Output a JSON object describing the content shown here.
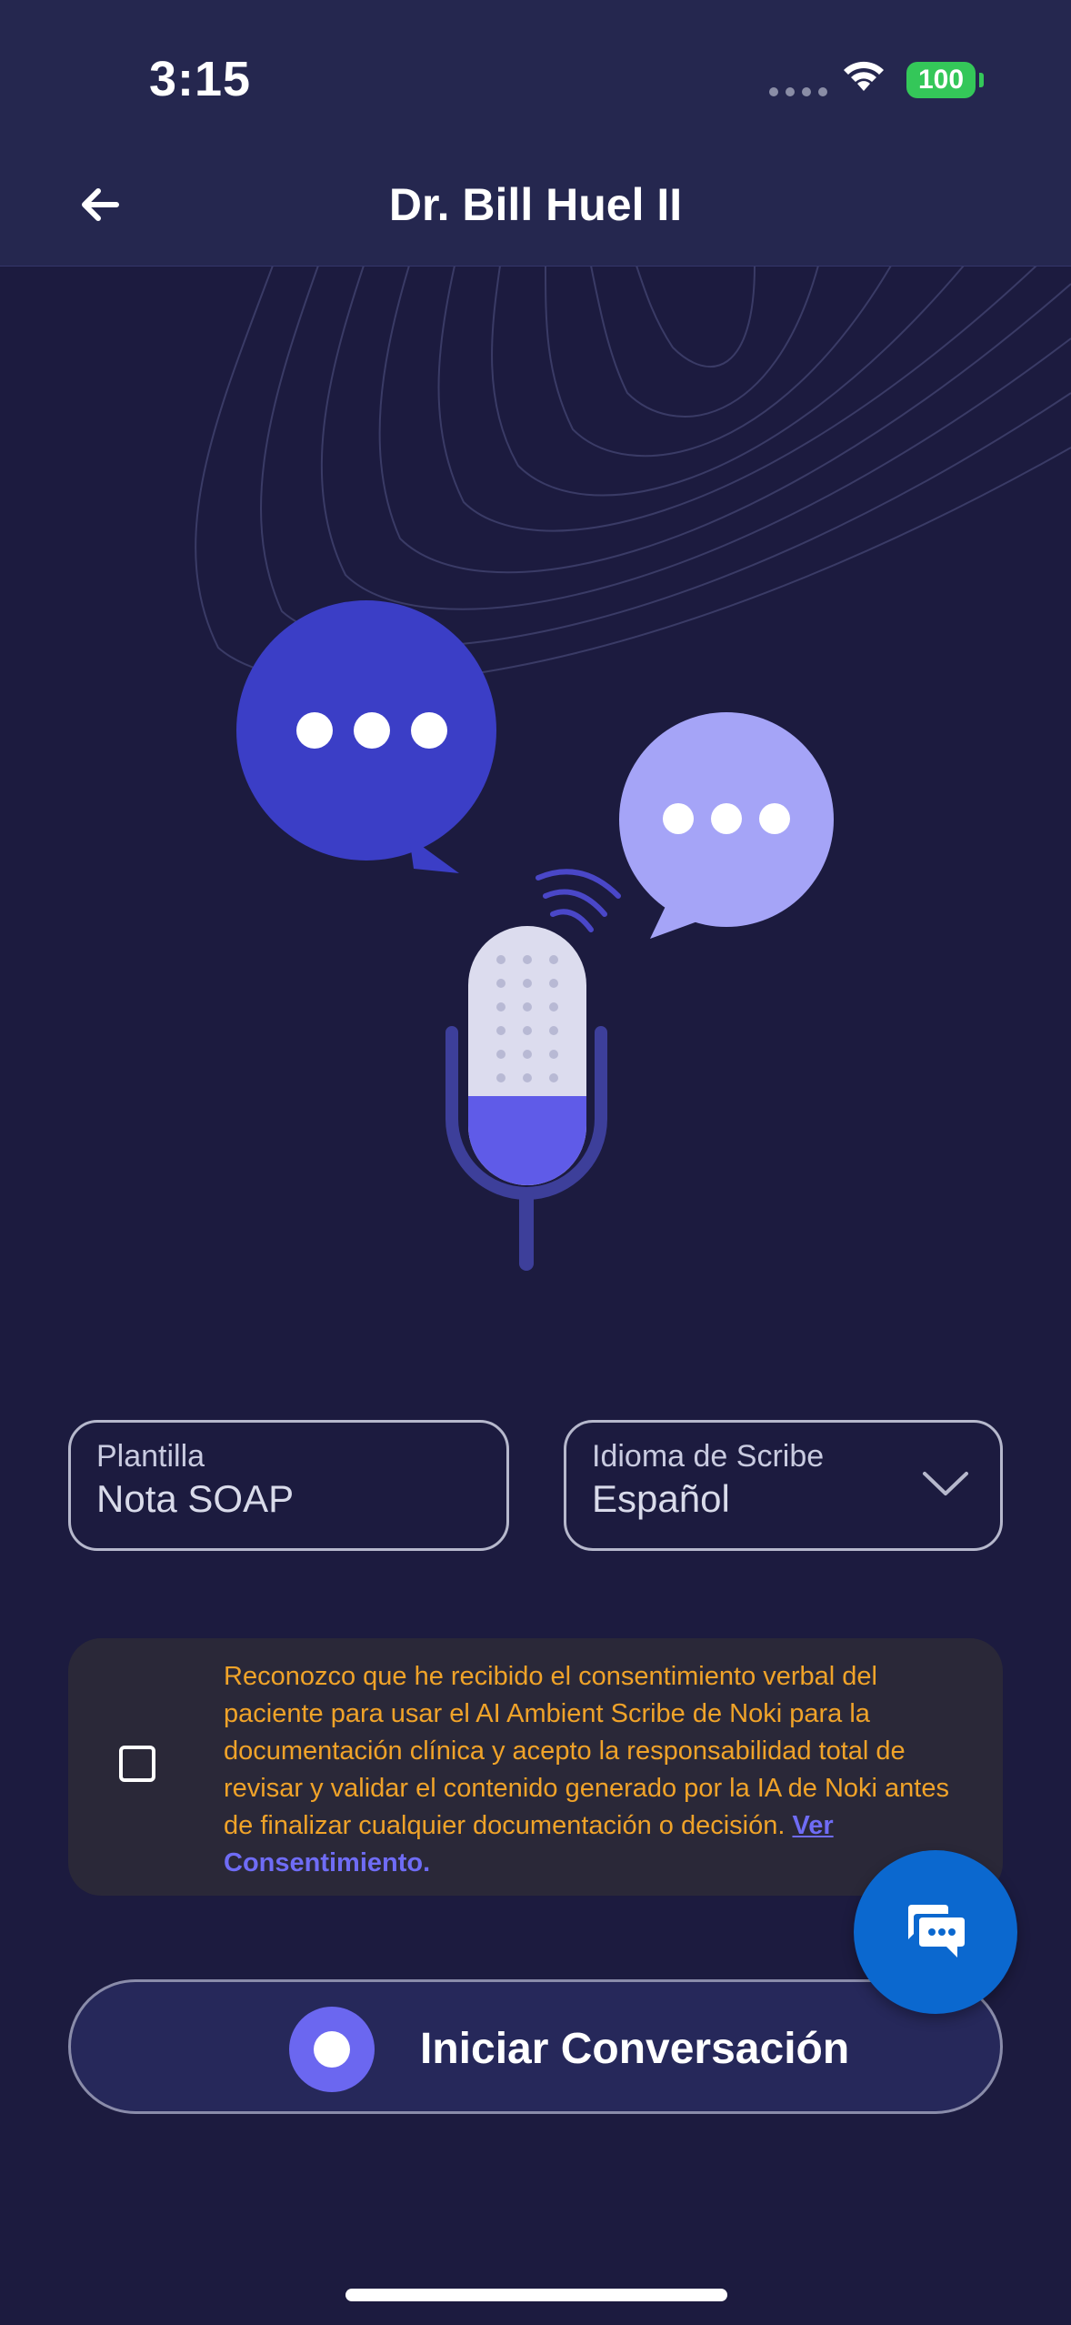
{
  "status_bar": {
    "time": "3:15",
    "battery": "100"
  },
  "header": {
    "title": "Dr. Bill Huel II"
  },
  "fields": {
    "template": {
      "label": "Plantilla",
      "value": "Nota SOAP"
    },
    "language": {
      "label": "Idioma de Scribe",
      "value": "Español"
    }
  },
  "consent": {
    "text": "Reconozco que he recibido el consentimiento verbal del paciente para usar el AI Ambient Scribe de Noki para la documentación clínica y acepto la responsabilidad total de revisar y validar el contenido generado por la IA de Noki antes de finalizar cualquier documentación o decisión. ",
    "link_part1": "Ver",
    "link_part2": "Consentimiento."
  },
  "start_button": {
    "label": "Iniciar Conversación"
  },
  "colors": {
    "background": "#1c1b3f",
    "header": "#25274f",
    "accent": "#6b67f0",
    "consent_text": "#f0a329",
    "fab": "#0b68cf"
  }
}
